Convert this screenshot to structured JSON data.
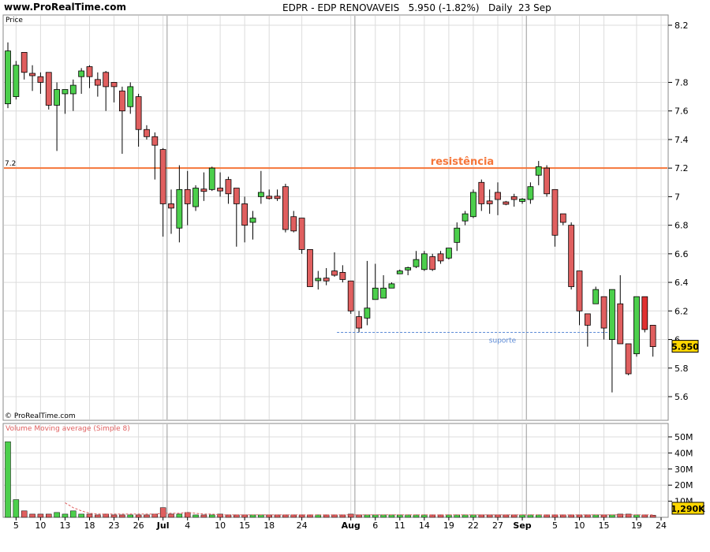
{
  "header": {
    "site": "www.ProRealTime.com",
    "title": "EDPR - EDP RENOVAVEIS   5.950 (-1.82%)   Daily  23 Sep"
  },
  "chart_data": {
    "type": "candlestick",
    "price_panel_label": "Price",
    "copyright": "© ProRealTime.com",
    "ylim": [
      5.45,
      8.3
    ],
    "y_ticks": [
      5.6,
      5.8,
      6,
      6.2,
      6.4,
      6.6,
      6.8,
      7,
      7.2,
      7.4,
      7.6,
      7.8,
      8.2
    ],
    "last_price_label": "5.950",
    "last_price": 5.95,
    "resistance": {
      "value": 7.2,
      "left_label": "7.2",
      "label": "resistência",
      "color": "#f5763a"
    },
    "support": {
      "value": 6.05,
      "label": "suporte",
      "color": "#5b8ad6"
    },
    "x_ticks": [
      {
        "label": "5",
        "i": 1
      },
      {
        "label": "10",
        "i": 4
      },
      {
        "label": "13",
        "i": 7
      },
      {
        "label": "18",
        "i": 10
      },
      {
        "label": "23",
        "i": 13
      },
      {
        "label": "26",
        "i": 16
      },
      {
        "label": "Jul",
        "i": 19,
        "bold": true
      },
      {
        "label": "4",
        "i": 22
      },
      {
        "label": "10",
        "i": 26
      },
      {
        "label": "15",
        "i": 29
      },
      {
        "label": "18",
        "i": 32
      },
      {
        "label": "24",
        "i": 36
      },
      {
        "label": "Aug",
        "i": 42,
        "bold": true
      },
      {
        "label": "6",
        "i": 45
      },
      {
        "label": "11",
        "i": 48
      },
      {
        "label": "14",
        "i": 51
      },
      {
        "label": "19",
        "i": 54
      },
      {
        "label": "22",
        "i": 57
      },
      {
        "label": "27",
        "i": 60
      },
      {
        "label": "Sep",
        "i": 63,
        "bold": true
      },
      {
        "label": "5",
        "i": 67
      },
      {
        "label": "10",
        "i": 70
      },
      {
        "label": "15",
        "i": 73
      },
      {
        "label": "19",
        "i": 77
      },
      {
        "label": "24",
        "i": 80
      }
    ],
    "month_lines": [
      19.5,
      42.5,
      63.5
    ],
    "candles": [
      {
        "o": 7.65,
        "h": 8.08,
        "l": 7.62,
        "c": 8.02
      },
      {
        "o": 7.7,
        "h": 7.95,
        "l": 7.68,
        "c": 7.92
      },
      {
        "o": 8.01,
        "h": 8.01,
        "l": 7.82,
        "c": 7.87
      },
      {
        "o": 7.86,
        "h": 7.92,
        "l": 7.74,
        "c": 7.85
      },
      {
        "o": 7.84,
        "h": 7.87,
        "l": 7.72,
        "c": 7.8
      },
      {
        "o": 7.87,
        "h": 7.87,
        "l": 7.61,
        "c": 7.64
      },
      {
        "o": 7.64,
        "h": 7.8,
        "l": 7.32,
        "c": 7.75
      },
      {
        "o": 7.72,
        "h": 7.75,
        "l": 7.58,
        "c": 7.75
      },
      {
        "o": 7.72,
        "h": 7.82,
        "l": 7.6,
        "c": 7.78
      },
      {
        "o": 7.84,
        "h": 7.9,
        "l": 7.72,
        "c": 7.88
      },
      {
        "o": 7.91,
        "h": 7.92,
        "l": 7.76,
        "c": 7.84
      },
      {
        "o": 7.82,
        "h": 7.87,
        "l": 7.7,
        "c": 7.78
      },
      {
        "o": 7.87,
        "h": 7.88,
        "l": 7.6,
        "c": 7.77
      },
      {
        "o": 7.8,
        "h": 7.8,
        "l": 7.66,
        "c": 7.77
      },
      {
        "o": 7.74,
        "h": 7.77,
        "l": 7.3,
        "c": 7.6
      },
      {
        "o": 7.63,
        "h": 7.8,
        "l": 7.58,
        "c": 7.77
      },
      {
        "o": 7.7,
        "h": 7.72,
        "l": 7.35,
        "c": 7.47
      },
      {
        "o": 7.47,
        "h": 7.5,
        "l": 7.4,
        "c": 7.42
      },
      {
        "o": 7.42,
        "h": 7.45,
        "l": 7.12,
        "c": 7.36
      },
      {
        "o": 7.33,
        "h": 7.34,
        "l": 6.72,
        "c": 6.95
      },
      {
        "o": 6.95,
        "h": 7.05,
        "l": 6.74,
        "c": 6.92
      },
      {
        "o": 6.78,
        "h": 7.22,
        "l": 6.68,
        "c": 7.05
      },
      {
        "o": 7.05,
        "h": 7.18,
        "l": 6.8,
        "c": 6.95
      },
      {
        "o": 6.93,
        "h": 7.08,
        "l": 6.9,
        "c": 7.06
      },
      {
        "o": 7.05,
        "h": 7.17,
        "l": 6.97,
        "c": 7.04
      },
      {
        "o": 7.05,
        "h": 7.21,
        "l": 7.04,
        "c": 7.2
      },
      {
        "o": 7.06,
        "h": 7.17,
        "l": 7.0,
        "c": 7.04
      },
      {
        "o": 7.12,
        "h": 7.14,
        "l": 6.95,
        "c": 7.02
      },
      {
        "o": 7.06,
        "h": 7.06,
        "l": 6.65,
        "c": 6.95
      },
      {
        "o": 6.95,
        "h": 7.0,
        "l": 6.68,
        "c": 6.8
      },
      {
        "o": 6.82,
        "h": 6.9,
        "l": 6.7,
        "c": 6.85
      },
      {
        "o": 7.0,
        "h": 7.18,
        "l": 6.95,
        "c": 7.03
      },
      {
        "o": 7.0,
        "h": 7.05,
        "l": 6.98,
        "c": 6.99
      },
      {
        "o": 7.0,
        "h": 7.05,
        "l": 6.97,
        "c": 6.99
      },
      {
        "o": 7.07,
        "h": 7.09,
        "l": 6.75,
        "c": 6.77
      },
      {
        "o": 6.86,
        "h": 6.9,
        "l": 6.75,
        "c": 6.76
      },
      {
        "o": 6.85,
        "h": 6.85,
        "l": 6.6,
        "c": 6.63
      },
      {
        "o": 6.63,
        "h": 6.63,
        "l": 6.37,
        "c": 6.37
      },
      {
        "o": 6.42,
        "h": 6.48,
        "l": 6.35,
        "c": 6.42
      },
      {
        "o": 6.43,
        "h": 6.5,
        "l": 6.38,
        "c": 6.41
      },
      {
        "o": 6.48,
        "h": 6.61,
        "l": 6.44,
        "c": 6.45
      },
      {
        "o": 6.47,
        "h": 6.52,
        "l": 6.4,
        "c": 6.42
      },
      {
        "o": 6.41,
        "h": 6.41,
        "l": 6.18,
        "c": 6.2
      },
      {
        "o": 6.16,
        "h": 6.2,
        "l": 6.05,
        "c": 6.08
      },
      {
        "o": 6.15,
        "h": 6.55,
        "l": 6.1,
        "c": 6.22
      },
      {
        "o": 6.28,
        "h": 6.53,
        "l": 6.28,
        "c": 6.36
      },
      {
        "o": 6.29,
        "h": 6.45,
        "l": 6.29,
        "c": 6.36
      },
      {
        "o": 6.36,
        "h": 6.4,
        "l": 6.36,
        "c": 6.39
      },
      {
        "o": 6.46,
        "h": 6.49,
        "l": 6.46,
        "c": 6.48
      },
      {
        "o": 6.49,
        "h": 6.51,
        "l": 6.45,
        "c": 6.5
      },
      {
        "o": 6.51,
        "h": 6.62,
        "l": 6.5,
        "c": 6.56
      },
      {
        "o": 6.49,
        "h": 6.62,
        "l": 6.48,
        "c": 6.6
      },
      {
        "o": 6.58,
        "h": 6.6,
        "l": 6.48,
        "c": 6.49
      },
      {
        "o": 6.6,
        "h": 6.62,
        "l": 6.53,
        "c": 6.55
      },
      {
        "o": 6.57,
        "h": 6.62,
        "l": 6.56,
        "c": 6.64
      },
      {
        "o": 6.68,
        "h": 6.82,
        "l": 6.62,
        "c": 6.78
      },
      {
        "o": 6.83,
        "h": 6.9,
        "l": 6.8,
        "c": 6.88
      },
      {
        "o": 6.86,
        "h": 7.05,
        "l": 6.85,
        "c": 7.03
      },
      {
        "o": 7.1,
        "h": 7.12,
        "l": 6.9,
        "c": 6.95
      },
      {
        "o": 6.97,
        "h": 7.05,
        "l": 6.88,
        "c": 6.95
      },
      {
        "o": 7.03,
        "h": 7.1,
        "l": 6.87,
        "c": 6.98
      },
      {
        "o": 6.96,
        "h": 6.97,
        "l": 6.94,
        "c": 6.95
      },
      {
        "o": 7.0,
        "h": 7.02,
        "l": 6.93,
        "c": 6.98
      },
      {
        "o": 6.97,
        "h": 6.99,
        "l": 6.95,
        "c": 6.98
      },
      {
        "o": 6.98,
        "h": 7.1,
        "l": 6.95,
        "c": 7.07
      },
      {
        "o": 7.15,
        "h": 7.25,
        "l": 7.08,
        "c": 7.21
      },
      {
        "o": 7.2,
        "h": 7.22,
        "l": 7.0,
        "c": 7.02
      },
      {
        "o": 7.05,
        "h": 7.05,
        "l": 6.65,
        "c": 6.73
      },
      {
        "o": 6.88,
        "h": 6.88,
        "l": 6.8,
        "c": 6.82
      },
      {
        "o": 6.8,
        "h": 6.82,
        "l": 6.35,
        "c": 6.37
      },
      {
        "o": 6.48,
        "h": 6.48,
        "l": 6.1,
        "c": 6.2
      },
      {
        "o": 6.18,
        "h": 6.18,
        "l": 5.95,
        "c": 6.1
      },
      {
        "o": 6.25,
        "h": 6.37,
        "l": 6.25,
        "c": 6.35
      },
      {
        "o": 6.3,
        "h": 6.3,
        "l": 6.0,
        "c": 6.08
      },
      {
        "o": 6.0,
        "h": 6.35,
        "l": 5.63,
        "c": 6.35
      },
      {
        "o": 6.25,
        "h": 6.45,
        "l": 5.98,
        "c": 5.97
      },
      {
        "o": 5.97,
        "h": 5.97,
        "l": 5.75,
        "c": 5.76
      },
      {
        "o": 5.9,
        "h": 6.3,
        "l": 5.88,
        "c": 6.3
      },
      {
        "o": 6.3,
        "h": 6.3,
        "l": 6.05,
        "c": 6.07
      },
      {
        "o": 6.1,
        "h": 6.1,
        "l": 5.88,
        "c": 5.95
      }
    ],
    "volume": {
      "label": "Volume Moving average (Simple 8)",
      "ylim": [
        0,
        58
      ],
      "y_ticks": [
        {
          "label": "10M",
          "v": 10
        },
        {
          "label": "20M",
          "v": 20
        },
        {
          "label": "30M",
          "v": 30
        },
        {
          "label": "40M",
          "v": 40
        },
        {
          "label": "50M",
          "v": 50
        }
      ],
      "last_label": "1,290K",
      "values": [
        47,
        11,
        4,
        2,
        2,
        2,
        3,
        2,
        4,
        2,
        2,
        1.5,
        2,
        1.5,
        1.5,
        1.5,
        1.5,
        1.5,
        2,
        6,
        2,
        2,
        3,
        1.5,
        1.5,
        1.5,
        2,
        1.5,
        1.5,
        1.5,
        1.5,
        1.5,
        1.5,
        1.5,
        1.5,
        1.5,
        1.5,
        1.5,
        1.5,
        1.5,
        1.5,
        1.5,
        2,
        1.5,
        1.5,
        1.5,
        1.5,
        1.5,
        1.5,
        1.5,
        1.5,
        1.5,
        1.5,
        1.5,
        1.5,
        1.5,
        1.5,
        1.5,
        1.5,
        1.5,
        1.5,
        1.5,
        1.5,
        1.5,
        1.5,
        1.5,
        1.5,
        1.5,
        1.5,
        1.5,
        1.5,
        1.5,
        1.5,
        1.5,
        1.5,
        2,
        2,
        1.5,
        1.5,
        1.3
      ],
      "ma_start": 7,
      "ma_values": [
        9,
        6,
        4,
        2.5,
        2,
        2,
        2,
        2,
        2,
        2,
        2,
        2,
        2.5,
        2.5,
        2.5,
        3,
        2.5,
        2,
        2,
        1.5,
        1.5,
        1.5,
        1.5,
        1.5,
        1.5,
        1.5,
        1.5,
        1.5,
        1.5,
        1.5,
        1.5,
        1.5,
        1.5,
        1.5,
        1.5,
        1.5,
        1.5,
        1.5,
        1.5,
        1.5,
        1.5,
        1.5,
        1.5,
        1.5,
        1.5,
        1.5,
        1.5,
        1.5,
        1.5,
        1.5,
        1.5,
        1.5,
        1.5,
        1.5,
        1.5,
        1.5,
        1.5,
        1.5,
        1.5,
        1.5,
        1.5,
        1.5,
        1.5,
        1.5,
        1.5,
        1.5,
        1.5,
        1.5,
        1.5,
        1.5,
        1.5,
        1.5,
        1.5
      ]
    },
    "colors": {
      "up": "#4ccf4c",
      "down": "#e05f5f",
      "grid": "#dcdcdc",
      "month_line": "#999999",
      "ma": "#e05f5f"
    }
  }
}
